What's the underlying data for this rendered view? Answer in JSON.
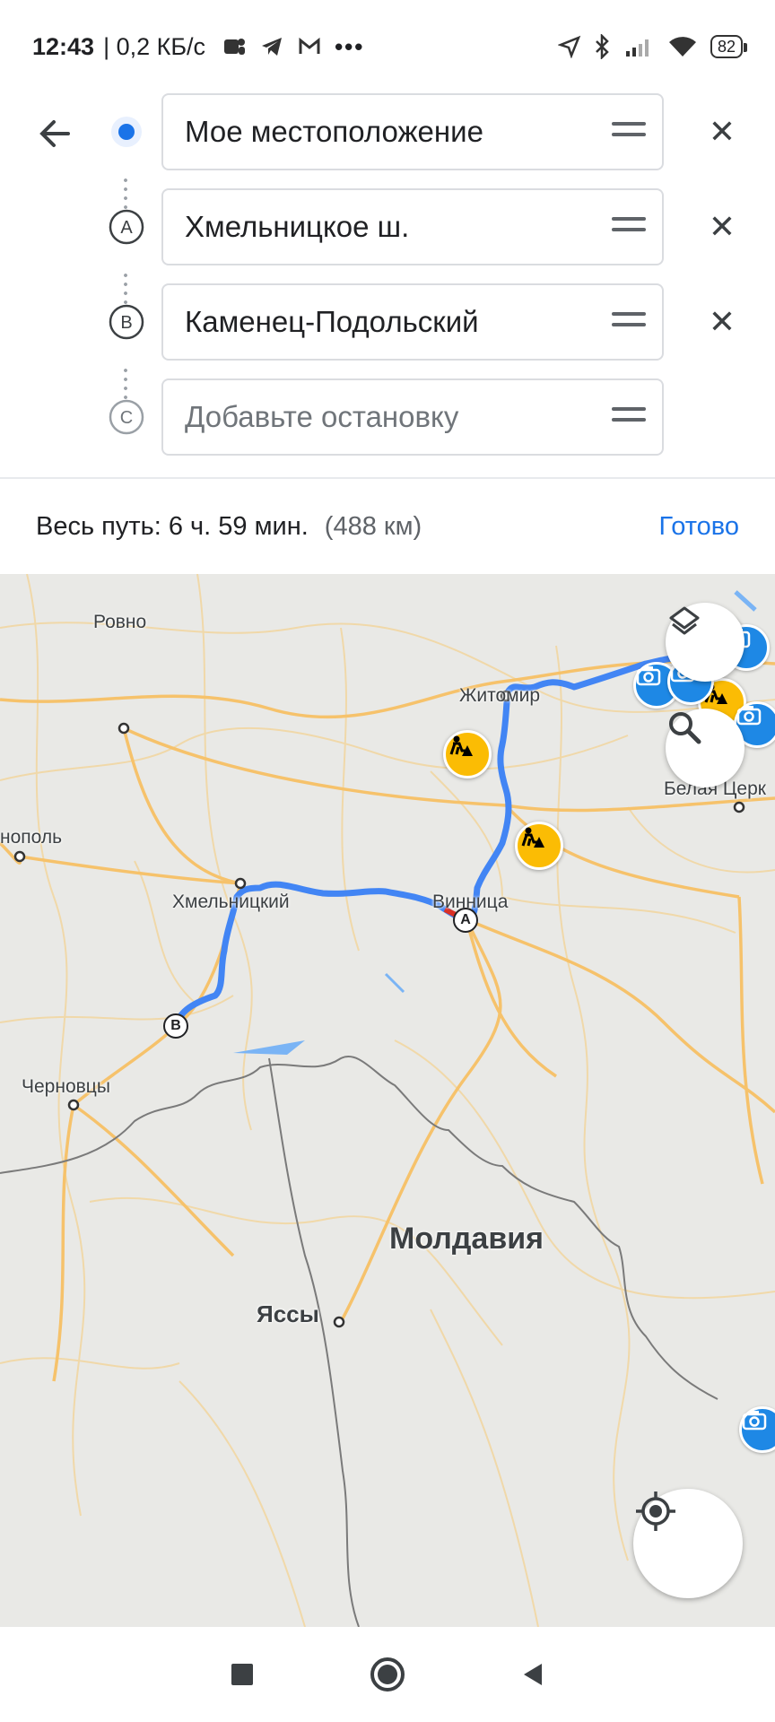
{
  "status_bar": {
    "time": "12:43",
    "network_speed": "| 0,2 КБ/с",
    "battery": "82",
    "icons_left": [
      "teams-icon",
      "telegram-icon",
      "gmail-icon",
      "more-dots-icon"
    ],
    "icons_right": [
      "location-arrow-icon",
      "bluetooth-icon",
      "signal-icon",
      "wifi-icon",
      "battery-icon"
    ]
  },
  "route": {
    "stops": [
      {
        "marker": "current-location",
        "label": "Мое местоположение"
      },
      {
        "marker": "A",
        "label": "Хмельницкое ш."
      },
      {
        "marker": "B",
        "label": "Каменец-Подольский"
      },
      {
        "marker": "C",
        "placeholder": "Добавьте остановку"
      }
    ]
  },
  "summary": {
    "total_label": "Весь путь: 6 ч. 59 мин.",
    "distance": "(488 км)",
    "done_label": "Готово"
  },
  "map": {
    "cities": {
      "rovno": "Ровно",
      "zhitomir": "Житомир",
      "belaya_tserkov": "Белая Церк",
      "ternopol": "нополь",
      "khmelnitsky": "Хмельницкий",
      "vinnitsa": "Винница",
      "chernovtsy": "Черновцы",
      "moldova": "Молдавия",
      "iasi": "Яссы"
    },
    "route_markers": [
      "A",
      "B"
    ],
    "colors": {
      "route": "#4285f4",
      "road": "#f6c26b",
      "border": "#7a7a7a",
      "camera": "#1e88e5",
      "roadwork": "#fbbc04"
    }
  },
  "nav": {
    "icons": [
      "recents-square-icon",
      "home-circle-icon",
      "back-triangle-icon"
    ]
  }
}
